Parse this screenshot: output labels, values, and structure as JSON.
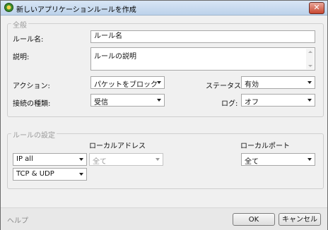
{
  "window": {
    "title": "新しいアプリケーションルールを作成"
  },
  "general": {
    "section_title": "全般",
    "rule_name_label": "ルール名:",
    "rule_name_value": "ルール名",
    "description_label": "説明:",
    "description_value": "ルールの説明",
    "action_label": "アクション:",
    "action_value": "パケットをブロック",
    "status_label": "ステータス:",
    "status_value": "有効",
    "connection_type_label": "接続の種類:",
    "connection_type_value": "受信",
    "log_label": "ログ:",
    "log_value": "オフ"
  },
  "rule_settings": {
    "section_title": "ルールの設定",
    "local_address_label": "ローカルアドレス",
    "local_port_label": "ローカルポート",
    "ip_value": "IP all",
    "address_value": "全て",
    "port_value": "全て",
    "protocol_value": "TCP & UDP"
  },
  "footer": {
    "help_label": "ヘルプ",
    "ok_label": "OK",
    "cancel_label": "キャンセル"
  },
  "colors": {
    "title_bar": "#c4d8ee",
    "close_button": "#c8462f",
    "group_title": "#9a9a9a"
  },
  "icons": {
    "app": "app-icon",
    "close": "close-icon"
  }
}
